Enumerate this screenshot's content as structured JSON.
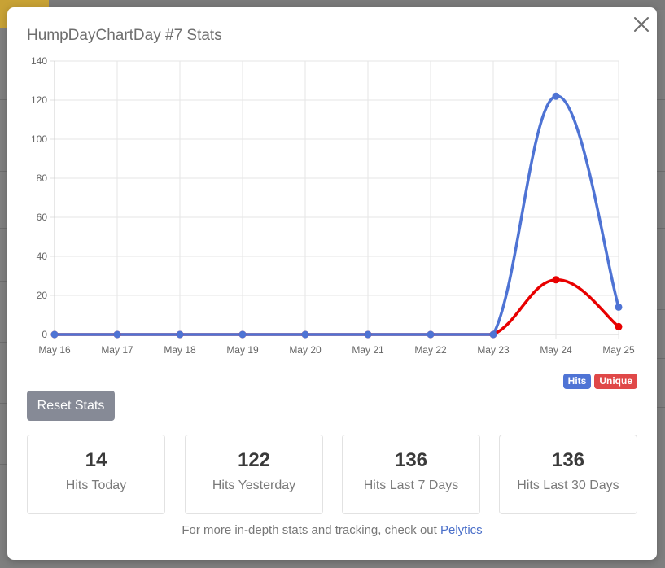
{
  "modal": {
    "title": "HumpDayChartDay #7 Stats",
    "close_label": "×",
    "reset_label": "Reset Stats"
  },
  "legend": {
    "hits": "Hits",
    "unique": "Unique"
  },
  "stats": [
    {
      "value": "14",
      "label": "Hits Today"
    },
    {
      "value": "122",
      "label": "Hits Yesterday"
    },
    {
      "value": "136",
      "label": "Hits Last 7 Days"
    },
    {
      "value": "136",
      "label": "Hits Last 30 Days"
    }
  ],
  "footer": {
    "text": "For more in-depth stats and tracking, check out ",
    "link": "Pelytics"
  },
  "colors": {
    "hits": "#4e73d4",
    "unique": "#e80000",
    "hits_badge": "#4f74d5",
    "unique_badge": "#e04848"
  },
  "chart_data": {
    "type": "line",
    "categories": [
      "May 16",
      "May 17",
      "May 18",
      "May 19",
      "May 20",
      "May 21",
      "May 22",
      "May 23",
      "May 24",
      "May 25"
    ],
    "series": [
      {
        "name": "Hits",
        "values": [
          0,
          0,
          0,
          0,
          0,
          0,
          0,
          0,
          122,
          14
        ]
      },
      {
        "name": "Unique",
        "values": [
          0,
          0,
          0,
          0,
          0,
          0,
          0,
          0,
          28,
          4
        ]
      }
    ],
    "ylim": [
      0,
      140
    ],
    "yticks": [
      0,
      20,
      40,
      60,
      80,
      100,
      120,
      140
    ],
    "grid": true,
    "legend_position": "bottom-right"
  }
}
